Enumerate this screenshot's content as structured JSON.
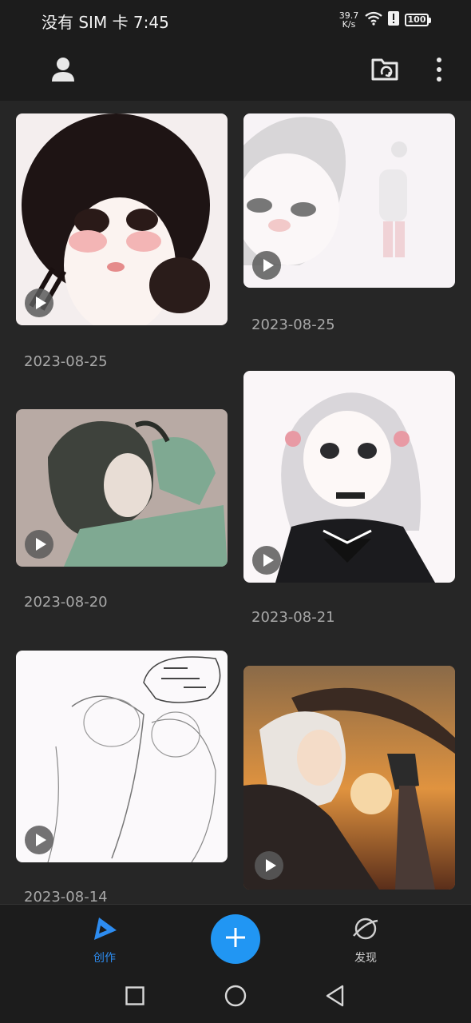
{
  "status_bar": {
    "carrier_time": "没有 SIM 卡 7:45",
    "net_speed_value": "39.7",
    "net_speed_unit": "K/s",
    "battery": "100"
  },
  "app_bar": {
    "profile_icon": "person-icon",
    "cloud_icon": "folder-sync-icon",
    "more_icon": "more-vertical-icon"
  },
  "works": [
    {
      "date": "2023-08-25",
      "palette": "#f4eeee"
    },
    {
      "date": "2023-08-25",
      "palette": "#f7f3f6"
    },
    {
      "date": "2023-08-20",
      "palette": "#b8aaa4"
    },
    {
      "date": "2023-08-21",
      "palette": "#faf6f8"
    },
    {
      "date": "2023-08-14",
      "palette": "#fbf9fb"
    },
    {
      "date": "",
      "palette": "#c77a3a"
    }
  ],
  "bottom_nav": {
    "create_label": "创作",
    "discover_label": "发现",
    "accent": "#2d8cf0",
    "fab_color": "#2196f3"
  }
}
